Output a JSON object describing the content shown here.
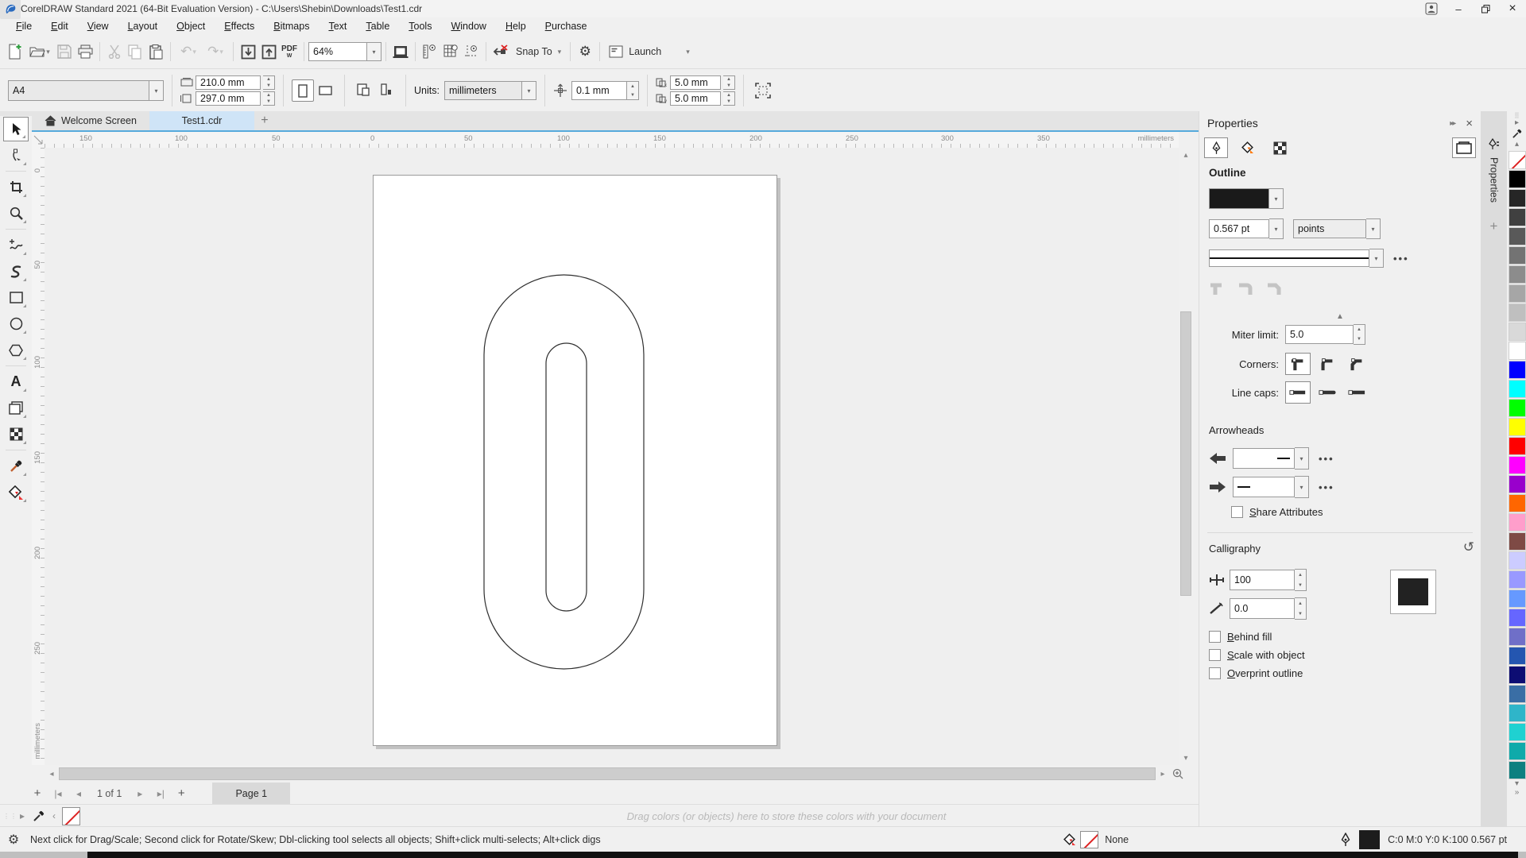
{
  "window": {
    "title": "CorelDRAW Standard 2021 (64-Bit Evaluation Version) - C:\\Users\\Shebin\\Downloads\\Test1.cdr"
  },
  "menubar": {
    "items": [
      "File",
      "Edit",
      "View",
      "Layout",
      "Object",
      "Effects",
      "Bitmaps",
      "Text",
      "Table",
      "Tools",
      "Window",
      "Help",
      "Purchase"
    ]
  },
  "toolbar": {
    "zoom_value": "64%",
    "pdf_label": "PDF",
    "snap_label": "Snap To",
    "launch_label": "Launch"
  },
  "property_bar": {
    "page_size": "A4",
    "width_value": "210.0 mm",
    "height_value": "297.0 mm",
    "units_label": "Units:",
    "units_value": "millimeters",
    "nudge_value": "0.1 mm",
    "dup_x": "5.0 mm",
    "dup_y": "5.0 mm"
  },
  "doc_tabs": {
    "welcome": "Welcome Screen",
    "active": "Test1.cdr",
    "new_tab": "+"
  },
  "rulers": {
    "h_numbers": [
      "150",
      "100",
      "50",
      "0",
      "50",
      "100",
      "150",
      "200",
      "250",
      "300",
      "350"
    ],
    "h_unit": "millimeters",
    "v_numbers": [
      "0",
      "50",
      "100",
      "150",
      "200",
      "250"
    ],
    "v_unit": "millimeters"
  },
  "toolbox": {
    "tools": [
      "Pick",
      "Shape",
      "Crop",
      "Zoom",
      "Freehand",
      "Artistic media",
      "Rectangle",
      "Ellipse",
      "Polygon",
      "Text",
      "Drop shadow",
      "Transparency",
      "Eyedropper",
      "Interactive fill"
    ]
  },
  "panel": {
    "header": "Properties",
    "docker_tab": "Properties",
    "outline_heading": "Outline",
    "width_value": "0.567 pt",
    "width_units": "points",
    "miter_label": "Miter limit:",
    "miter_value": "5.0",
    "corners_label": "Corners:",
    "line_caps_label": "Line caps:",
    "arrowheads_heading": "Arrowheads",
    "share_attributes_label": "Share Attributes",
    "calligraphy_heading": "Calligraphy",
    "stretch_value": "100",
    "angle_value": "0.0",
    "behind_fill_label": "Behind fill",
    "scale_with_object_label": "Scale with object",
    "overprint_label": "Overprint outline"
  },
  "palette": {
    "colors": [
      "none",
      "#000000",
      "#262626",
      "#404040",
      "#595959",
      "#737373",
      "#8c8c8c",
      "#a6a6a6",
      "#bfbfbf",
      "#d9d9d9",
      "#ffffff",
      "#0000ff",
      "#00ffff",
      "#00ff00",
      "#ffff00",
      "#ff0000",
      "#ff00ff",
      "#9900cc",
      "#ff6600",
      "#ff9ecb",
      "#7e4a45",
      "#ccccff",
      "#9999ff",
      "#6699ff",
      "#6666ff",
      "#6f6fc8",
      "#2456b0",
      "#0d0d73",
      "#3a6ea5",
      "#2fb5c9",
      "#1fd1d1",
      "#0faaaa",
      "#0d8080"
    ]
  },
  "page_nav": {
    "counter": "1 of 1",
    "page_tab": "Page 1"
  },
  "document_palette": {
    "hint": "Drag colors (or objects) here to store these colors with your document"
  },
  "status_bar": {
    "tip": "Next click for Drag/Scale; Second click for Rotate/Skew; Dbl-clicking tool selects all objects; Shift+click multi-selects; Alt+click digs",
    "fill_none": "None",
    "outline_values": "C:0 M:0 Y:0 K:100  0.567 pt"
  },
  "theme": {
    "active_tab_bg": "#cfe4f7",
    "tab_underline": "#56aadc",
    "outline_swatch": "#1a1a1a"
  }
}
